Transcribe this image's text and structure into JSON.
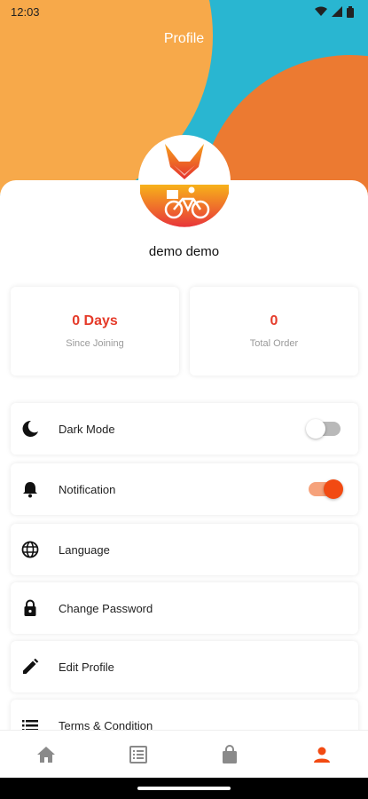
{
  "status_bar": {
    "time": "12:03"
  },
  "header": {
    "title": "Profile"
  },
  "profile": {
    "name": "demo demo"
  },
  "stats": [
    {
      "value": "0 Days",
      "label": "Since Joining"
    },
    {
      "value": "0",
      "label": "Total Order"
    }
  ],
  "settings": {
    "dark_mode": {
      "label": "Dark Mode",
      "enabled": false
    },
    "notification": {
      "label": "Notification",
      "enabled": true
    },
    "language": {
      "label": "Language"
    },
    "change_password": {
      "label": "Change Password"
    },
    "edit_profile": {
      "label": "Edit Profile"
    },
    "terms": {
      "label": "Terms & Condition"
    }
  },
  "bottom_nav": [
    {
      "icon": "home-icon",
      "active": false
    },
    {
      "icon": "orders-list-icon",
      "active": false
    },
    {
      "icon": "shopping-bag-icon",
      "active": false
    },
    {
      "icon": "person-icon",
      "active": true
    }
  ],
  "colors": {
    "accent": "#f24a12",
    "stat_value": "#e53b2a",
    "header_blue": "#29b6d1",
    "header_orange": "#f7a94a",
    "header_red_orange": "#ec7a31",
    "inactive_nav": "#8a8a8a"
  }
}
